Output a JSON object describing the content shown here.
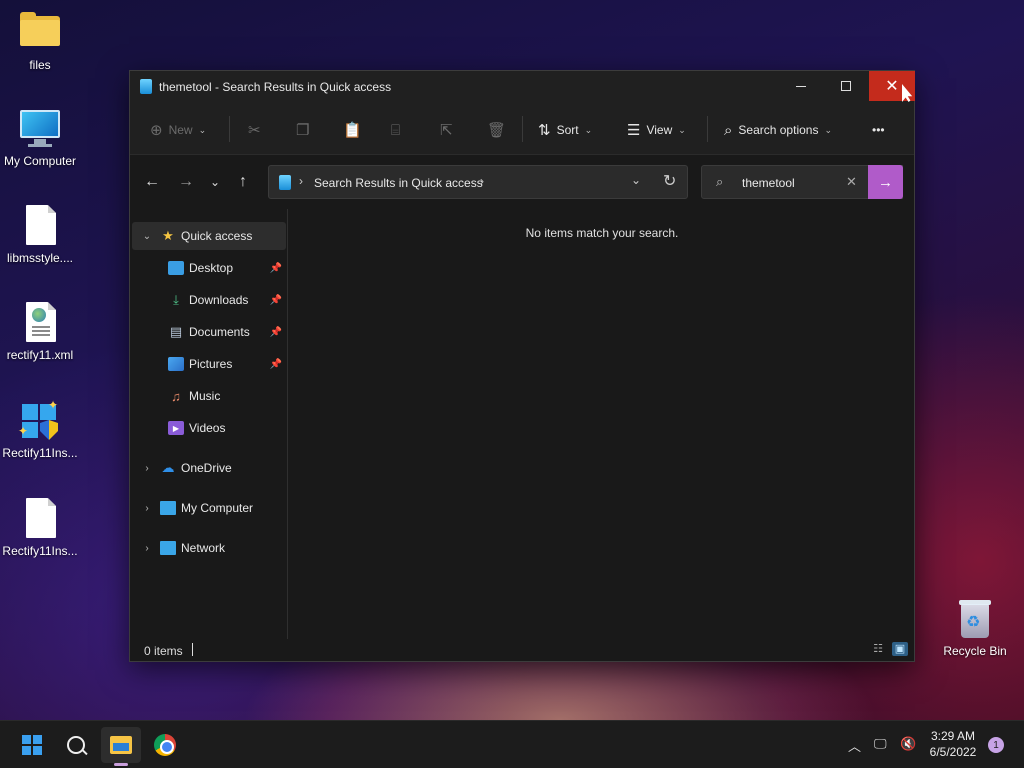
{
  "desktop": {
    "icons": [
      {
        "label": "files"
      },
      {
        "label": "My Computer"
      },
      {
        "label": "libmsstyle...."
      },
      {
        "label": "rectify11.xml"
      },
      {
        "label": "Rectify11Ins..."
      },
      {
        "label": "Rectify11Ins..."
      },
      {
        "label": "Recycle Bin"
      }
    ]
  },
  "window": {
    "title": "themetool - Search Results in Quick access",
    "toolbar": {
      "new_label": "New",
      "sort_label": "Sort",
      "view_label": "View",
      "search_options_label": "Search options",
      "more_label": "•••"
    },
    "address": {
      "path": "Search Results in Quick access"
    },
    "search": {
      "value": "themetool"
    },
    "sidebar": {
      "items": [
        {
          "label": "Quick access"
        },
        {
          "label": "Desktop"
        },
        {
          "label": "Downloads"
        },
        {
          "label": "Documents"
        },
        {
          "label": "Pictures"
        },
        {
          "label": "Music"
        },
        {
          "label": "Videos"
        },
        {
          "label": "OneDrive"
        },
        {
          "label": "My Computer"
        },
        {
          "label": "Network"
        }
      ]
    },
    "content": {
      "empty_message": "No items match your search."
    },
    "status": {
      "items_count": "0 items"
    }
  },
  "taskbar": {
    "clock_time": "3:29 AM",
    "clock_date": "6/5/2022",
    "notification_count": "1"
  },
  "colors": {
    "accent": "#b05bc9",
    "close_hover": "#c42b1c",
    "window_bg": "#191919",
    "taskbar_bg": "#1c1c1c"
  }
}
